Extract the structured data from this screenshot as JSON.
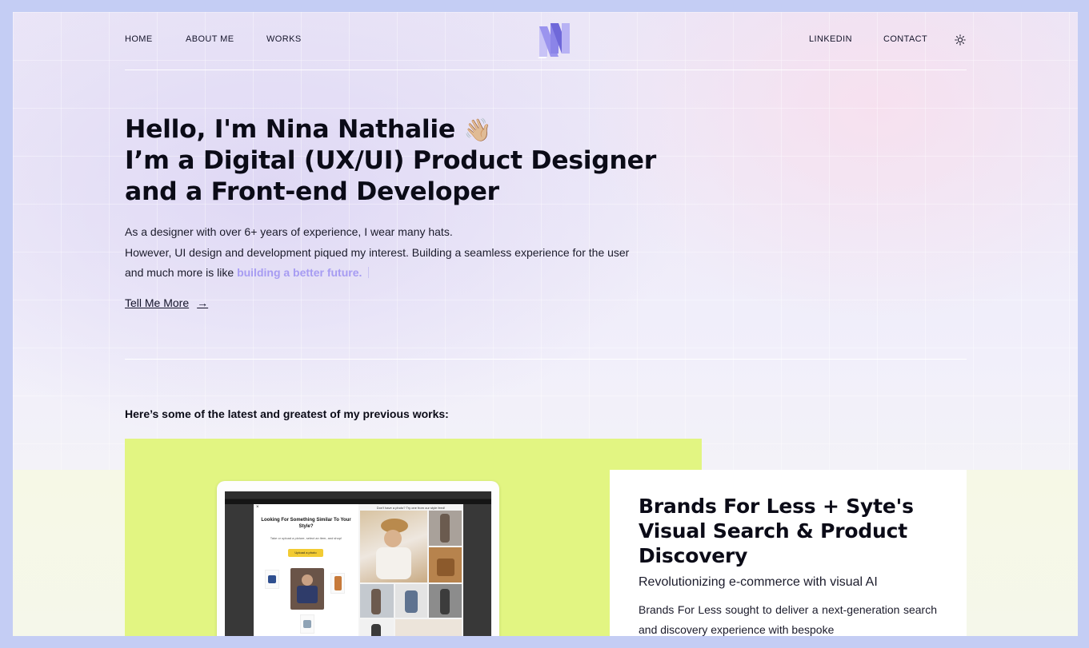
{
  "nav": {
    "home": "HOME",
    "about": "ABOUT ME",
    "works": "WORKS",
    "linkedin": "LINKEDIN",
    "contact": "CONTACT",
    "logo_letters": "NN",
    "theme_icon": "sun-icon"
  },
  "hero": {
    "title_line1": "Hello, I'm Nina Nathalie",
    "wave_emoji": "👋🏼",
    "title_line2": "I’m a Digital (UX/UI) Product Designer",
    "title_line3": "and a Front-end Developer",
    "text_line1": "As a designer with over 6+ years of experience, I wear many hats.",
    "text_line2": "However, UI design and development piqued my interest. Building a seamless experience for the user",
    "text_line3": "and much more is like",
    "text_highlight": "building a better future.",
    "cta_label": "Tell Me More",
    "cta_arrow": "→"
  },
  "works_intro": "Here’s some of the latest and greatest of my previous works:",
  "work": {
    "title": "Brands For Less + Syte's Visual Search & Product Discovery",
    "subtitle": "Revolutionizing e-commerce with visual AI",
    "description": "Brands For Less sought to deliver a next-generation search and discovery experience with bespoke",
    "mockup": {
      "modal_heading": "Looking For Something Similar To Your Style?",
      "modal_text": "Take or upload a picture, select an item, and shop!",
      "upload_button": "Upload a photo",
      "results_header": "Don't have a photo? Try one from our style feed!",
      "close": "×"
    }
  },
  "colors": {
    "accent_purple": "#a79cf2",
    "logo_purple": "#8b84e8",
    "card_lime": "#e2f582",
    "frame": "#c4cdf4"
  }
}
